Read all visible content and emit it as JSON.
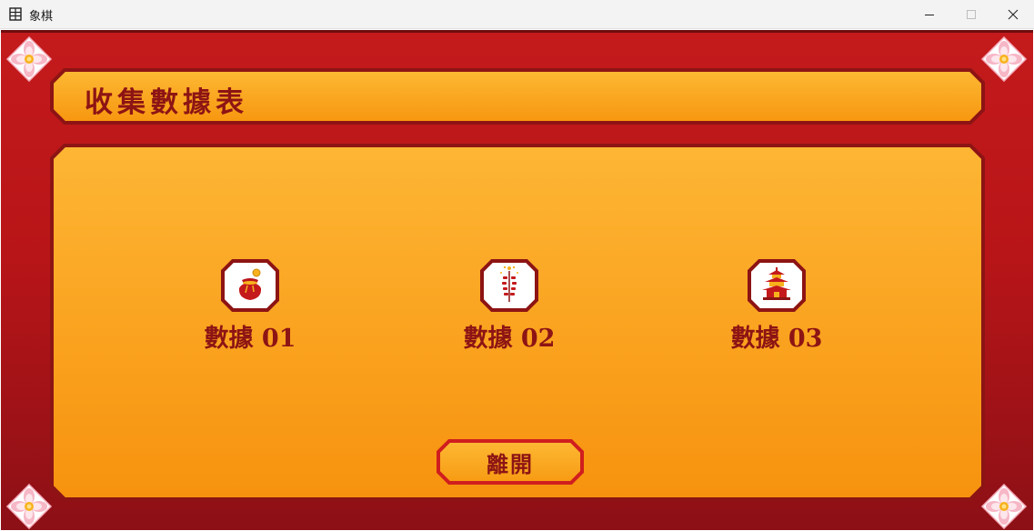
{
  "window": {
    "title": "象棋",
    "app_icon": "chessboard-icon",
    "controls": [
      "minimize-icon",
      "maximize-icon",
      "close-icon"
    ]
  },
  "header": {
    "title": "收集數據表"
  },
  "slots": [
    {
      "label": "數據 01",
      "icon": "money-pouch-icon"
    },
    {
      "label": "數據 02",
      "icon": "firecracker-icon"
    },
    {
      "label": "數據 03",
      "icon": "pagoda-icon"
    }
  ],
  "exit_button": {
    "label": "離開"
  },
  "colors": {
    "background_red": "#c41a1c",
    "panel_gold": "#fbb234",
    "panel_orange": "#f7920e",
    "border_dark_red": "#8d1414",
    "text_dark_red": "#8d1414"
  }
}
